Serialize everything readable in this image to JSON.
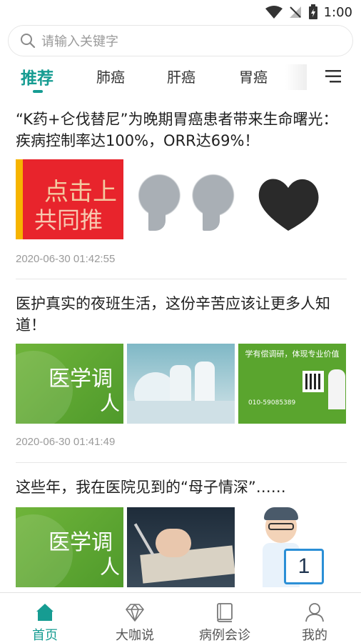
{
  "status_bar": {
    "time": "1:00"
  },
  "search": {
    "placeholder": "请输入关键字"
  },
  "tabs": [
    {
      "label": "推荐",
      "active": true
    },
    {
      "label": "肺癌",
      "active": false
    },
    {
      "label": "肝癌",
      "active": false
    },
    {
      "label": "胃癌",
      "active": false
    }
  ],
  "articles": [
    {
      "title": "“K药+仑伐替尼”为晚期胃癌患者带来生命曙光：疾病控制率达100%，ORR达69%！",
      "date": "2020-06-30 01:42:55",
      "thumb_texts": [
        "点击上",
        "共同推"
      ]
    },
    {
      "title": "医护真实的夜班生活，这份辛苦应该让更多人知道！",
      "date": "2020-06-30 01:41:49",
      "thumb_texts": [
        "医学调",
        "人",
        "学有偿调研，体现专业价值",
        "010-59085389"
      ]
    },
    {
      "title": "这些年，我在医院见到的“母子情深”……",
      "thumb_texts": [
        "医学调",
        "人",
        "1"
      ]
    }
  ],
  "bottom_nav": [
    {
      "label": "首页",
      "icon": "home-icon",
      "active": true
    },
    {
      "label": "大咖说",
      "icon": "diamond-icon",
      "active": false
    },
    {
      "label": "病例会诊",
      "icon": "book-icon",
      "active": false
    },
    {
      "label": "我的",
      "icon": "user-icon",
      "active": false
    }
  ],
  "colors": {
    "accent": "#169c92"
  }
}
